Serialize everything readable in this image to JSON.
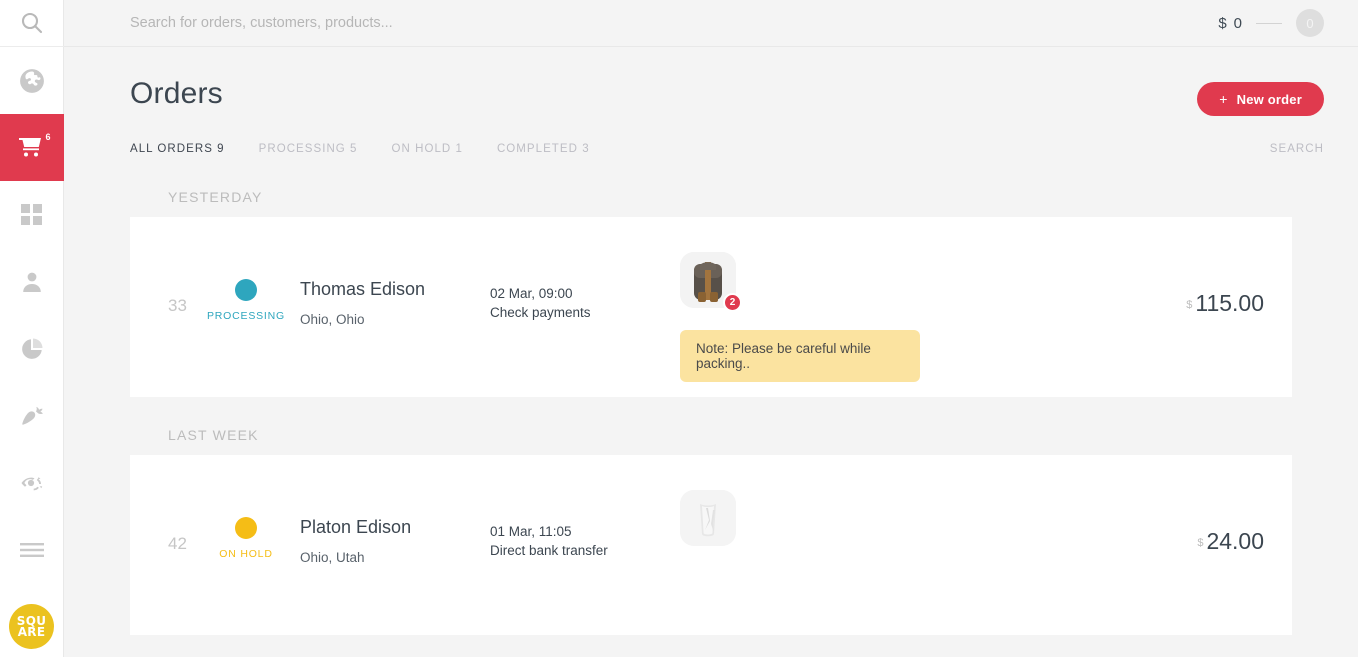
{
  "sidebar": {
    "items": [
      {
        "name": "search",
        "icon": "search-icon"
      },
      {
        "name": "globe",
        "icon": "globe-icon"
      },
      {
        "name": "orders",
        "icon": "cart-icon",
        "badge": "6",
        "active": true
      },
      {
        "name": "dashboard",
        "icon": "grid-icon"
      },
      {
        "name": "customers",
        "icon": "person-icon"
      },
      {
        "name": "analytics",
        "icon": "pie-chart-icon"
      },
      {
        "name": "products",
        "icon": "carrot-icon"
      },
      {
        "name": "sync",
        "icon": "eye-sync-icon"
      },
      {
        "name": "menu",
        "icon": "hamburger-icon"
      }
    ],
    "logo_line1": "SQU",
    "logo_line2": "ARE"
  },
  "topbar": {
    "search_placeholder": "Search for orders, customers, products...",
    "search_value": "",
    "cart_currency": "$",
    "cart_amount": "0",
    "cart_count": "0"
  },
  "header": {
    "title": "Orders",
    "new_order_plus": "+",
    "new_order_label": "New order"
  },
  "tabs": [
    {
      "label": "ALL ORDERS 9",
      "active": true
    },
    {
      "label": "PROCESSING 5",
      "active": false
    },
    {
      "label": "ON HOLD 1",
      "active": false
    },
    {
      "label": "COMPLETED 3",
      "active": false
    }
  ],
  "search_link": "SEARCH",
  "groups": [
    {
      "label": "YESTERDAY",
      "order": {
        "number": "33",
        "status": "PROCESSING",
        "status_color": "#2ea6be",
        "customer": "Thomas Edison",
        "location": "Ohio, Ohio",
        "date": "02 Mar, 09:00",
        "payment": "Check payments",
        "item_qty": "2",
        "note": "Note: Please be careful while packing..",
        "price_currency": "$",
        "price": "115.00"
      }
    },
    {
      "label": "LAST WEEK",
      "order": {
        "number": "42",
        "status": "ON HOLD",
        "status_color": "#f5bd16",
        "customer": "Platon Edison",
        "location": "Ohio, Utah",
        "date": "01 Mar, 11:05",
        "payment": "Direct bank transfer",
        "item_qty": "",
        "note": "",
        "price_currency": "$",
        "price": "24.00"
      }
    }
  ]
}
